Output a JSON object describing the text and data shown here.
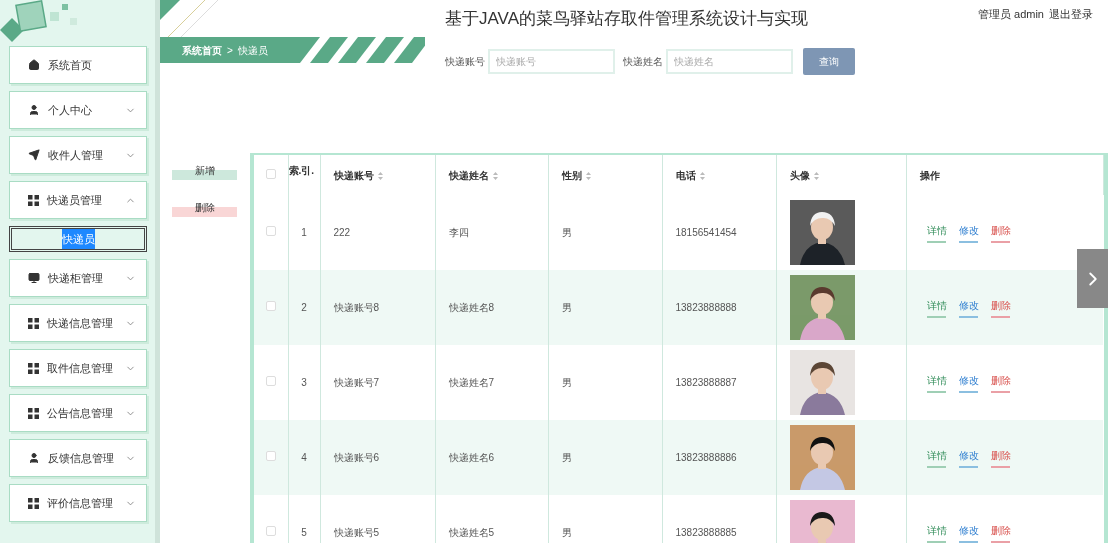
{
  "sidebar": {
    "items": [
      {
        "label": "系统首页",
        "kind": "link"
      },
      {
        "label": "个人中心",
        "kind": "menu",
        "expanded": false
      },
      {
        "label": "收件人管理",
        "kind": "menu",
        "expanded": false
      },
      {
        "label": "快递员管理",
        "kind": "menu",
        "expanded": true,
        "children": [
          {
            "label": "快递员",
            "selected": true
          }
        ]
      },
      {
        "label": "快递柜管理",
        "kind": "menu",
        "expanded": false
      },
      {
        "label": "快递信息管理",
        "kind": "menu",
        "expanded": false
      },
      {
        "label": "取件信息管理",
        "kind": "menu",
        "expanded": false
      },
      {
        "label": "公告信息管理",
        "kind": "menu",
        "expanded": false
      },
      {
        "label": "反馈信息管理",
        "kind": "menu",
        "expanded": false
      },
      {
        "label": "评价信息管理",
        "kind": "menu",
        "expanded": false
      }
    ]
  },
  "breadcrumb": {
    "items": [
      "系统首页",
      "快递员"
    ],
    "separator": ">"
  },
  "title": "基于JAVA的菜鸟驿站存取件管理系统设计与实现",
  "user": {
    "role": "管理员",
    "name": "admin",
    "logout": "退出登录"
  },
  "search": {
    "fields": [
      {
        "label": "快递账号",
        "placeholder": "快递账号"
      },
      {
        "label": "快递姓名",
        "placeholder": "快递姓名"
      }
    ],
    "button": "查询"
  },
  "actions": [
    {
      "label": "新增",
      "kind": "add"
    },
    {
      "label": "删除",
      "kind": "delete"
    }
  ],
  "table": {
    "header_checked": false,
    "columns": [
      {
        "label": "索.引.",
        "sortable": false
      },
      {
        "label": "快递账号",
        "sortable": true
      },
      {
        "label": "快递姓名",
        "sortable": true
      },
      {
        "label": "性别",
        "sortable": true
      },
      {
        "label": "电话",
        "sortable": true
      },
      {
        "label": "头像",
        "sortable": true
      },
      {
        "label": "操作",
        "sortable": false
      }
    ],
    "rows": [
      {
        "checked": false,
        "index": "1",
        "account": "222",
        "name": "李四",
        "gender": "男",
        "phone": "18156541454",
        "actions": [
          {
            "label": "详情",
            "kind": "detail"
          },
          {
            "label": "修改",
            "kind": "edit"
          },
          {
            "label": "删除",
            "kind": "delete"
          }
        ]
      },
      {
        "checked": false,
        "index": "2",
        "account": "快递账号8",
        "name": "快递姓名8",
        "gender": "男",
        "phone": "13823888888",
        "actions": [
          {
            "label": "详情",
            "kind": "detail"
          },
          {
            "label": "修改",
            "kind": "edit"
          },
          {
            "label": "删除",
            "kind": "delete"
          }
        ]
      },
      {
        "checked": false,
        "index": "3",
        "account": "快递账号7",
        "name": "快递姓名7",
        "gender": "男",
        "phone": "13823888887",
        "actions": [
          {
            "label": "详情",
            "kind": "detail"
          },
          {
            "label": "修改",
            "kind": "edit"
          },
          {
            "label": "删除",
            "kind": "delete"
          }
        ]
      },
      {
        "checked": false,
        "index": "4",
        "account": "快递账号6",
        "name": "快递姓名6",
        "gender": "男",
        "phone": "13823888886",
        "actions": [
          {
            "label": "详情",
            "kind": "detail"
          },
          {
            "label": "修改",
            "kind": "edit"
          },
          {
            "label": "删除",
            "kind": "delete"
          }
        ]
      },
      {
        "checked": false,
        "index": "5",
        "account": "快递账号5",
        "name": "快递姓名5",
        "gender": "男",
        "phone": "13823888885",
        "actions": [
          {
            "label": "详情",
            "kind": "detail"
          },
          {
            "label": "修改",
            "kind": "edit"
          },
          {
            "label": "删除",
            "kind": "delete"
          }
        ]
      }
    ]
  }
}
